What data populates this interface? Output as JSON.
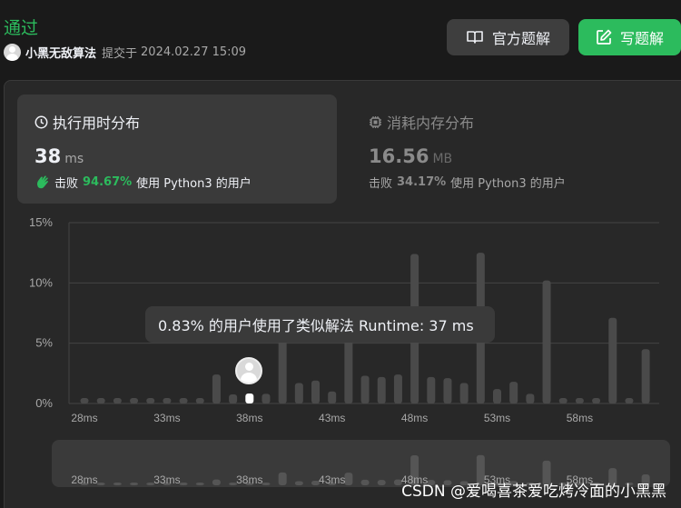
{
  "header": {
    "status": "通过",
    "user_name": "小黑无敌算法",
    "submit_prefix": "提交于",
    "submit_time": "2024.02.27 15:09",
    "btn_official": "官方题解",
    "btn_write": "写题解"
  },
  "runtime_tab": {
    "title": "执行用时分布",
    "value": "38",
    "unit": "ms",
    "beat_label": "击败",
    "beat_pct": "94.67%",
    "beat_suffix": "使用 Python3 的用户"
  },
  "memory_tab": {
    "title": "消耗内存分布",
    "value": "16.56",
    "unit": "MB",
    "beat_label": "击败",
    "beat_pct": "34.17%",
    "beat_suffix": "使用 Python3 的用户"
  },
  "tooltip": "0.83% 的用户使用了类似解法 Runtime: 37 ms",
  "watermark": "CSDN @爱喝喜茶爱吃烤冷面的小黑黑",
  "colors": {
    "accent_green": "#2cbb5d",
    "bar": "#4a4a4a",
    "bar_selected": "#ffffff"
  },
  "chart_data": {
    "type": "bar",
    "xlabel": "",
    "ylabel": "",
    "ylim": [
      0,
      15
    ],
    "y_ticks": [
      "0%",
      "5%",
      "10%",
      "15%"
    ],
    "x_ticks": [
      "28ms",
      "33ms",
      "38ms",
      "43ms",
      "48ms",
      "53ms",
      "58ms"
    ],
    "categories": [
      28,
      29,
      30,
      31,
      32,
      33,
      34,
      35,
      36,
      37,
      38,
      39,
      40,
      41,
      42,
      43,
      44,
      45,
      46,
      47,
      48,
      49,
      50,
      51,
      52,
      53,
      54,
      55,
      56,
      57,
      58,
      59,
      60,
      61,
      62
    ],
    "values": [
      0.45,
      0.45,
      0.45,
      0.45,
      0.45,
      0.45,
      0.45,
      0.45,
      2.4,
      0.75,
      0.83,
      0.8,
      5.3,
      1.7,
      1.9,
      1.0,
      5.2,
      2.3,
      2.2,
      2.4,
      12.4,
      2.2,
      2.1,
      1.7,
      12.5,
      1.2,
      1.8,
      0.8,
      10.2,
      0.45,
      0.45,
      0.45,
      7.1,
      0.45,
      4.5
    ],
    "selected_ms": 38,
    "grid": true
  },
  "mini_chart": {
    "x_ticks": [
      "28ms",
      "33ms",
      "38ms",
      "43ms",
      "48ms",
      "53ms",
      "58ms"
    ]
  }
}
